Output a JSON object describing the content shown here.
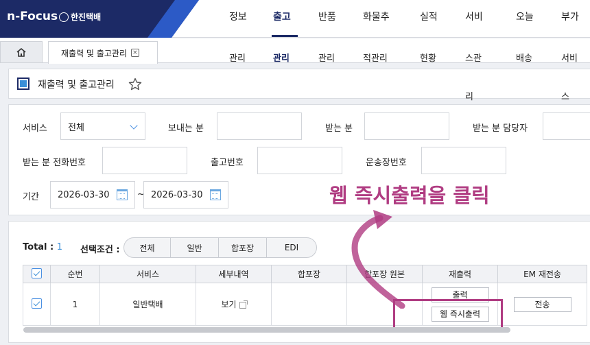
{
  "brand": {
    "name": "n-Focus",
    "sub": "한진택배"
  },
  "menu": [
    {
      "top": "정보",
      "sub": [
        "관리"
      ]
    },
    {
      "top": "출고",
      "sub": [
        "관리"
      ],
      "active": true
    },
    {
      "top": "반품",
      "sub": [
        "관리"
      ]
    },
    {
      "top": "화물추",
      "sub": [
        "적관리"
      ]
    },
    {
      "top": "실적",
      "sub": [
        "현황"
      ]
    },
    {
      "top": "서비",
      "sub": [
        "스관",
        "리"
      ]
    },
    {
      "top": "오늘",
      "sub": [
        "배송"
      ]
    },
    {
      "top": "부가",
      "sub": [
        "서비",
        "스"
      ]
    }
  ],
  "tabs": {
    "page_tab": "재출력 및 출고관리",
    "close": "×"
  },
  "page_title": "재출력 및 출고관리",
  "filters": {
    "service_label": "서비스",
    "service_value": "전체",
    "sender_label": "보내는 분",
    "receiver_label": "받는 분",
    "receiver_manager_label": "받는 분 담당자",
    "receiver_phone_label": "받는 분 전화번호",
    "release_no_label": "출고번호",
    "waybill_no_label": "운송장번호",
    "period_label": "기간",
    "date_from": "2026-03-30",
    "date_tilde": "~",
    "date_to": "2026-03-30"
  },
  "annotation": "웹 즉시출력을 클릭",
  "grid": {
    "total_label": "Total :",
    "total_count": "1",
    "condition_label": "선택조건 :",
    "conditions": [
      "전체",
      "일반",
      "합포장",
      "EDI"
    ],
    "columns": [
      "",
      "순번",
      "서비스",
      "세부내역",
      "합포장",
      "합포장 원본",
      "재출력",
      "EM 재전송"
    ],
    "rows": [
      {
        "seq": "1",
        "service": "일반택배",
        "detail": "보기",
        "reprint": "출력",
        "web_print": "웹 즉시출력",
        "em_resend": "전송"
      }
    ]
  },
  "colors": {
    "navy": "#1c2a66",
    "accent": "#3a8fd8",
    "annotation": "#b03c82"
  }
}
